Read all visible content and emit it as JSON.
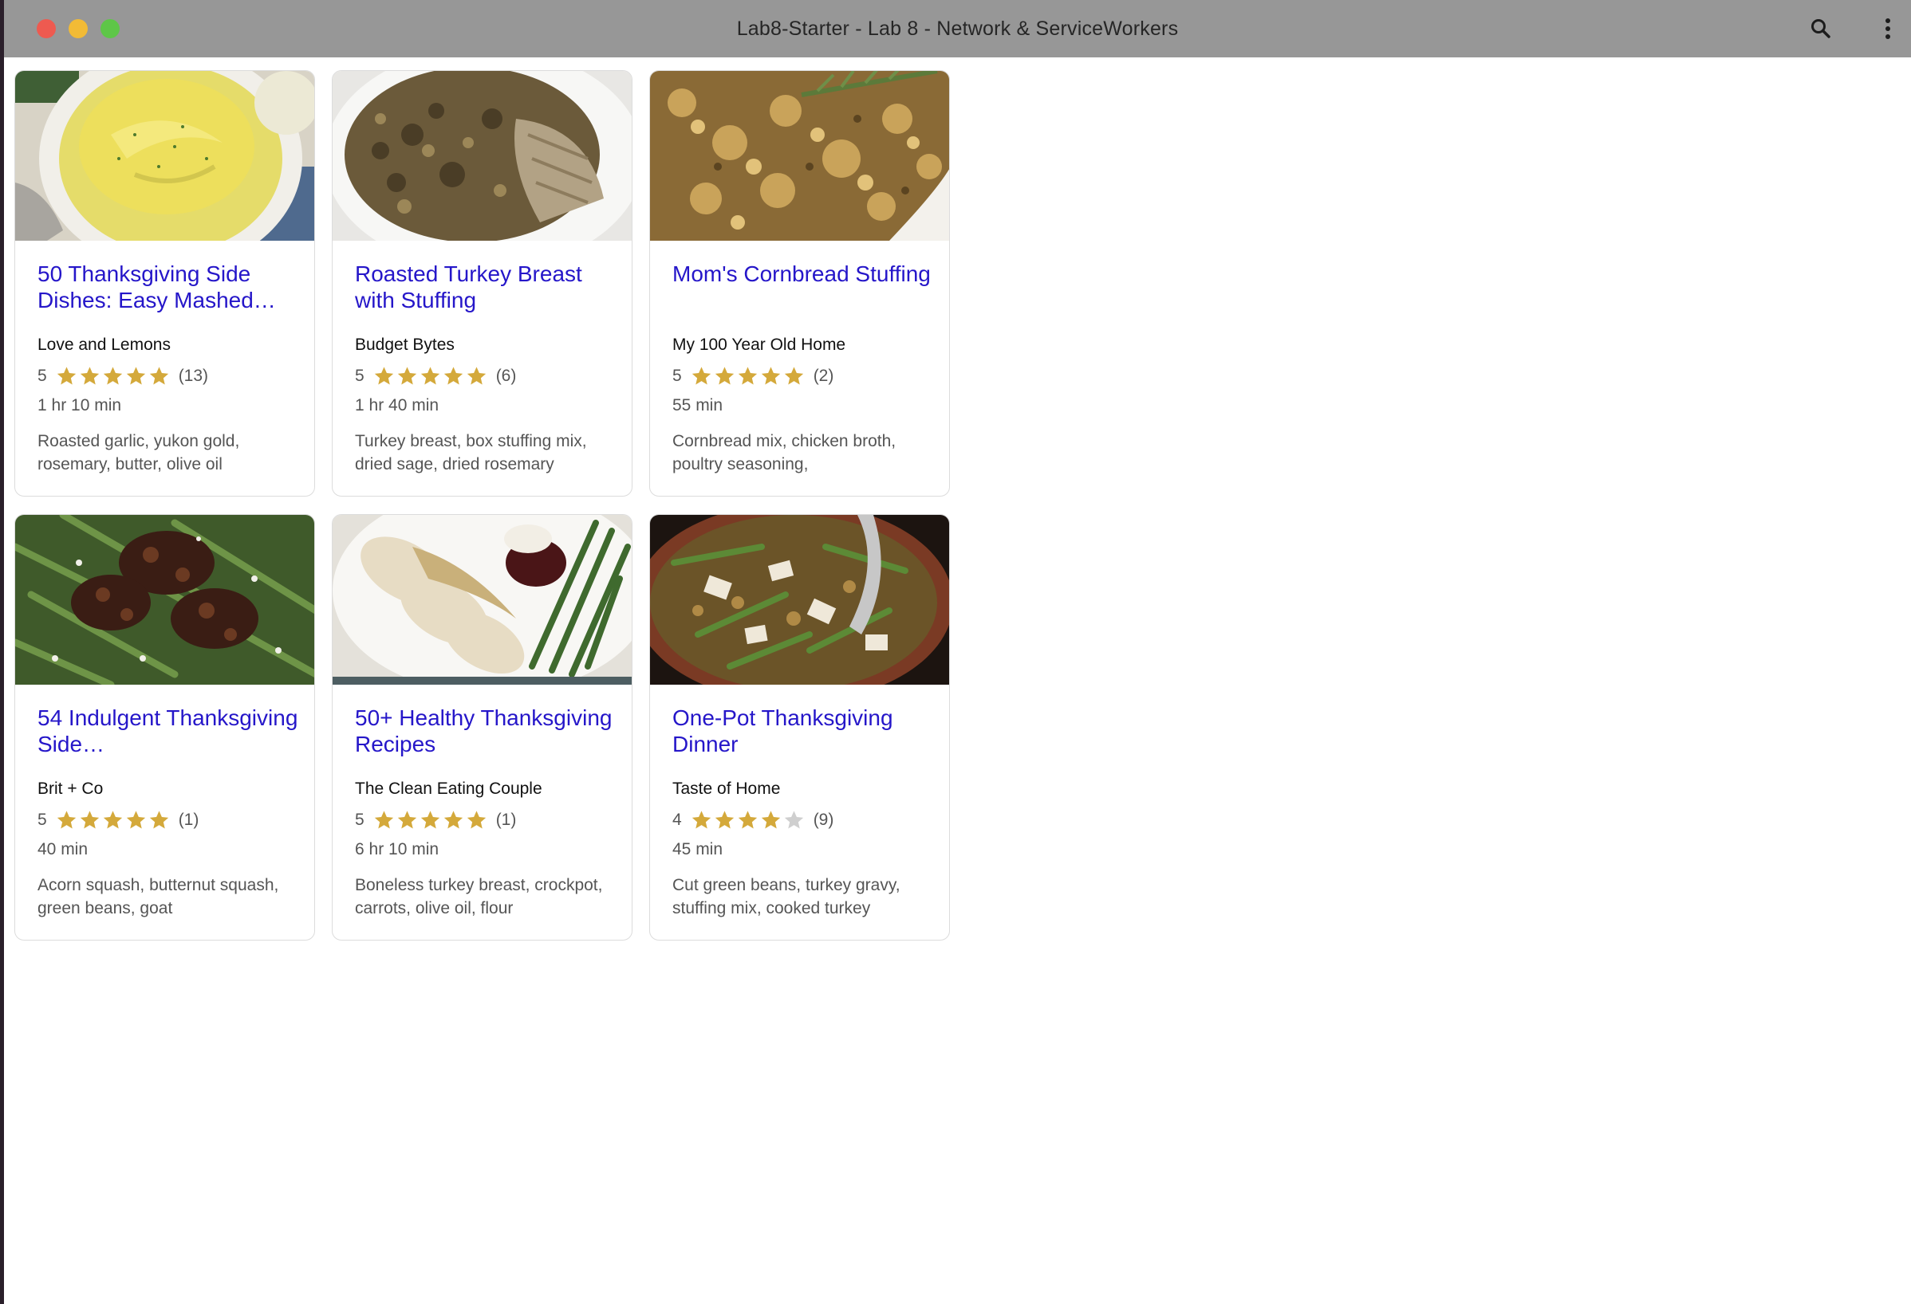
{
  "window": {
    "title": "Lab8-Starter - Lab 8 - Network & ServiceWorkers",
    "icons": [
      "search-icon",
      "more-vertical-icon"
    ]
  },
  "colors": {
    "title_link": "#2516c9",
    "star_filled": "#d4a93b",
    "star_empty": "#cfcfcf",
    "titlebar": "#979797"
  },
  "recipes": [
    {
      "title": "50 Thanksgiving Side Dishes: Easy Mashed…",
      "org": "Love and Lemons",
      "rating": "5",
      "stars": 5,
      "reviews": "(13)",
      "time": "1 hr 10 min",
      "ingredients": "Roasted garlic, yukon gold, rosemary, butter, olive oil",
      "image": "mashed-potatoes-bowl"
    },
    {
      "title": "Roasted Turkey Breast with Stuffing",
      "org": "Budget Bytes",
      "rating": "5",
      "stars": 5,
      "reviews": "(6)",
      "time": "1 hr 40 min",
      "ingredients": "Turkey breast, box stuffing mix, dried sage, dried rosemary",
      "image": "turkey-stuffing-plate"
    },
    {
      "title": "Mom's Cornbread Stuffing",
      "org": "My 100 Year Old Home",
      "rating": "5",
      "stars": 5,
      "reviews": "(2)",
      "time": "55 min",
      "ingredients": "Cornbread mix, chicken broth, poultry seasoning,",
      "image": "cornbread-stuffing"
    },
    {
      "title": "54 Indulgent Thanksgiving Side…",
      "org": "Brit + Co",
      "rating": "5",
      "stars": 5,
      "reviews": "(1)",
      "time": "40 min",
      "ingredients": "Acorn squash, butternut squash, green beans, goat",
      "image": "green-beans-pecans"
    },
    {
      "title": "50+ Healthy Thanksgiving Recipes",
      "org": "The Clean Eating Couple",
      "rating": "5",
      "stars": 5,
      "reviews": "(1)",
      "time": "6 hr 10 min",
      "ingredients": "Boneless turkey breast, crockpot, carrots, olive oil, flour",
      "image": "turkey-gravy-plate"
    },
    {
      "title": "One-Pot Thanksgiving Dinner",
      "org": "Taste of Home",
      "rating": "4",
      "stars": 4,
      "reviews": "(9)",
      "time": "45 min",
      "ingredients": "Cut green beans, turkey gravy, stuffing mix, cooked turkey",
      "image": "one-pot-dinner"
    }
  ]
}
